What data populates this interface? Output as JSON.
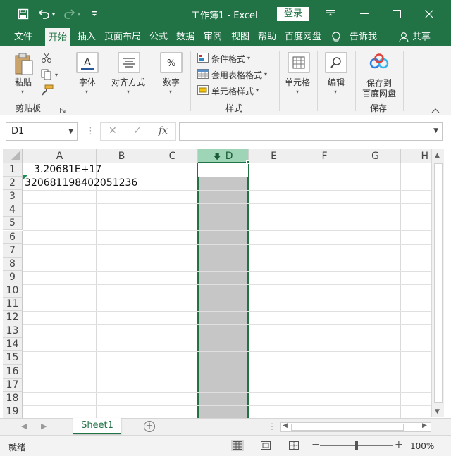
{
  "titlebar": {
    "title": "工作簿1  -  Excel",
    "login_label": "登录",
    "save_icon": "save-icon",
    "undo_icon": "undo-icon",
    "redo_icon": "redo-icon",
    "customize_icon": "customize-qat-icon"
  },
  "tabs": [
    "文件",
    "开始",
    "插入",
    "页面布局",
    "公式",
    "数据",
    "审阅",
    "视图",
    "帮助",
    "百度网盘",
    "告诉我",
    "共享"
  ],
  "active_tab": "开始",
  "ribbon": {
    "clipboard": {
      "paste_label": "粘贴",
      "group_label": "剪贴板"
    },
    "font": {
      "label": "字体"
    },
    "alignment": {
      "label": "对齐方式"
    },
    "number": {
      "label": "数字"
    },
    "styles": {
      "conditional": "条件格式",
      "table": "套用表格格式",
      "cell_styles": "单元格样式",
      "group_label": "样式"
    },
    "cells": {
      "label": "单元格"
    },
    "editing": {
      "label": "编辑"
    },
    "baidu": {
      "line1": "保存到",
      "line2": "百度网盘",
      "group_label": "保存"
    }
  },
  "formula_bar": {
    "name_box": "D1",
    "cancel_glyph": "✕",
    "enter_glyph": "✓",
    "fx_label": "fx",
    "formula": ""
  },
  "grid": {
    "columns": [
      "A",
      "B",
      "C",
      "D",
      "E",
      "F",
      "G",
      "H"
    ],
    "selected_column": "D",
    "rows": [
      "1",
      "2",
      "3",
      "4",
      "5",
      "6",
      "7",
      "8",
      "9",
      "10",
      "11",
      "12",
      "13",
      "14",
      "15",
      "16",
      "17",
      "18",
      "19"
    ],
    "cells": {
      "A1": "3.20681E+17",
      "A2": "320681198402051236"
    }
  },
  "sheets": {
    "tabs": [
      "Sheet1"
    ],
    "active": "Sheet1"
  },
  "status": {
    "mode": "就绪",
    "zoom": "100%",
    "zoom_minus": "−",
    "zoom_plus": "+"
  },
  "colors": {
    "accent": "#217346",
    "selection_fill": "#c6c6c6",
    "header_selected": "#9fd5b7"
  }
}
